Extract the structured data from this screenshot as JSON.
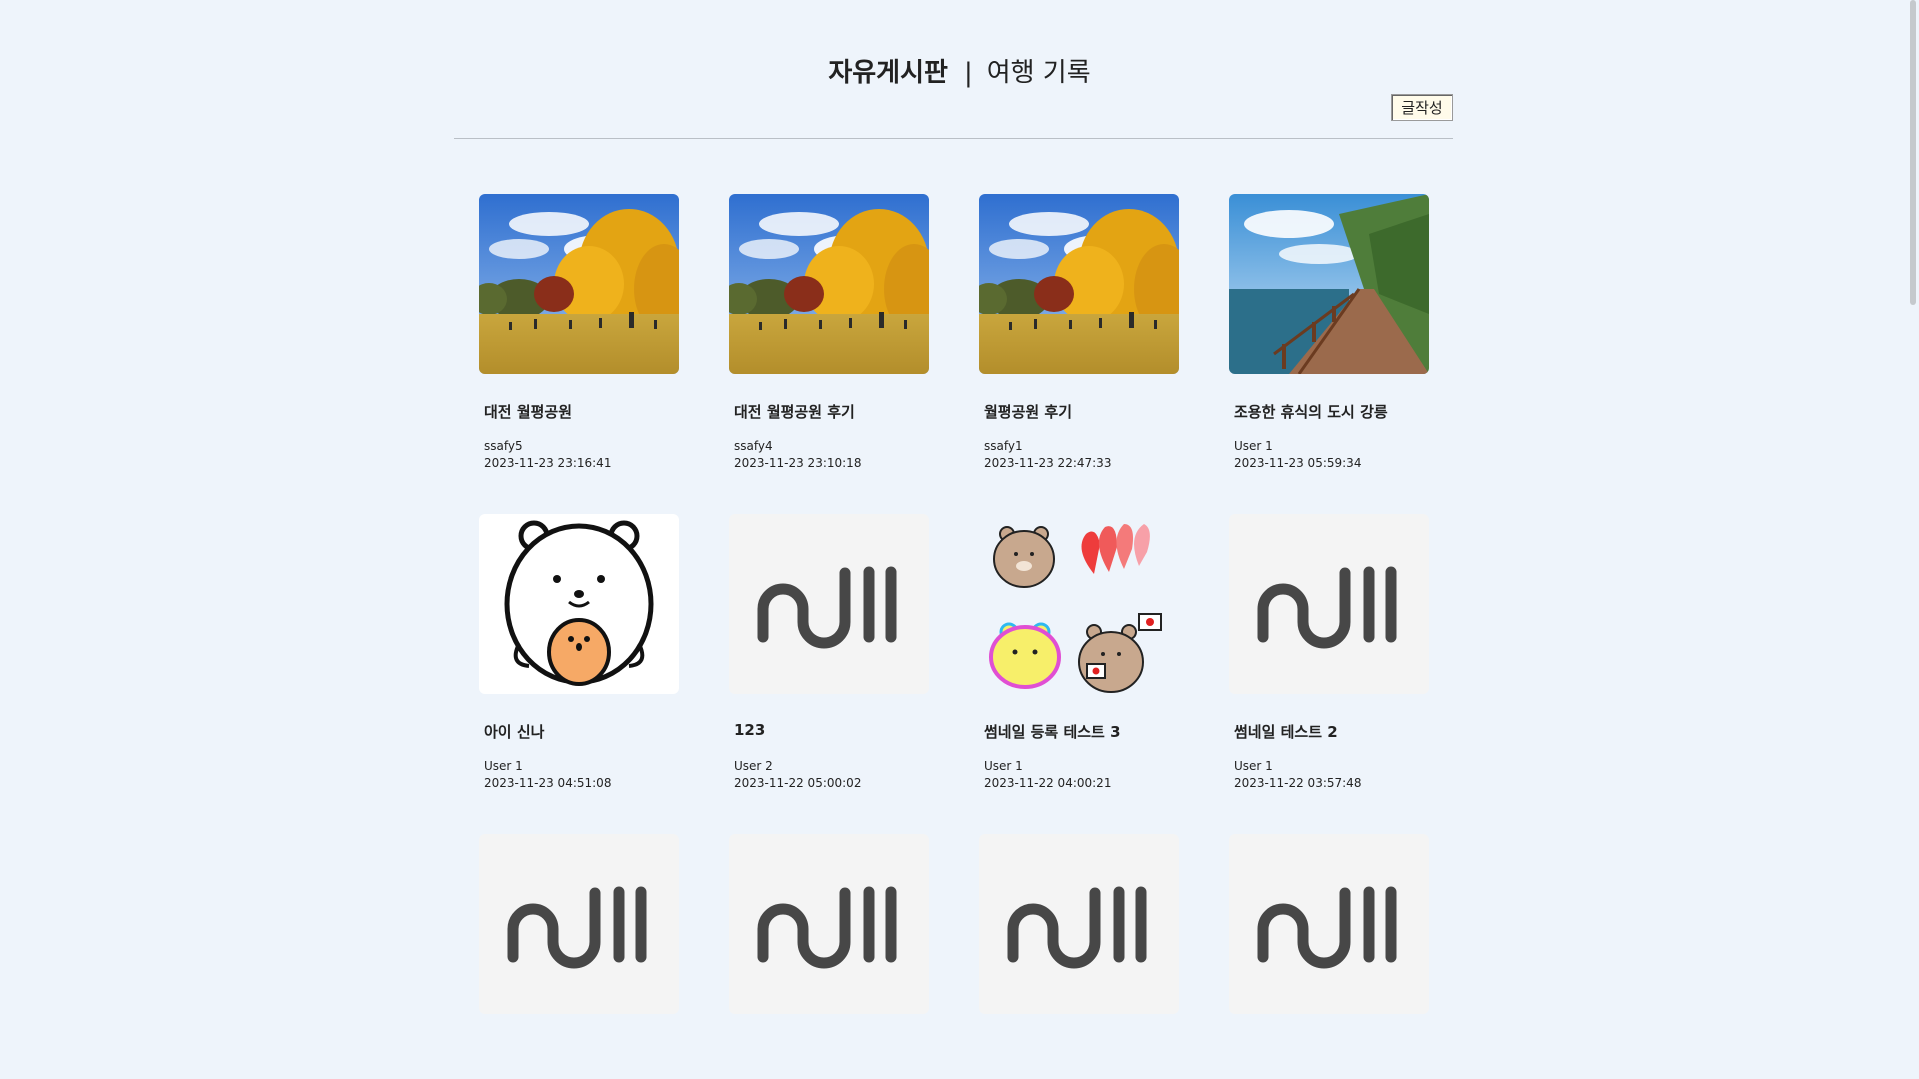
{
  "header": {
    "board": "자유게시판",
    "separator": "|",
    "travel": "여행 기록"
  },
  "write_button": "글작성",
  "posts": [
    {
      "title": "대전 월평공원",
      "author": "ssafy5",
      "date": "2023-11-23 23:16:41",
      "thumb": "ginkgo-park-photo"
    },
    {
      "title": "대전 월평공원 후기",
      "author": "ssafy4",
      "date": "2023-11-23 23:10:18",
      "thumb": "ginkgo-park-photo"
    },
    {
      "title": "월평공원 후기",
      "author": "ssafy1",
      "date": "2023-11-23 22:47:33",
      "thumb": "ginkgo-park-photo"
    },
    {
      "title": "조용한 휴식의 도시 강릉",
      "author": "User 1",
      "date": "2023-11-23 05:59:34",
      "thumb": "coast-boardwalk-photo"
    },
    {
      "title": "아이 신나",
      "author": "User 1",
      "date": "2023-11-23 04:51:08",
      "thumb": "bear-illustration"
    },
    {
      "title": "123",
      "author": "User 2",
      "date": "2023-11-22 05:00:02",
      "thumb": "null-placeholder"
    },
    {
      "title": "썸네일 등록 테스트 3",
      "author": "User 1",
      "date": "2023-11-22 04:00:21",
      "thumb": "bear-stickers"
    },
    {
      "title": "썸네일 테스트 2",
      "author": "User 1",
      "date": "2023-11-22 03:57:48",
      "thumb": "null-placeholder"
    },
    {
      "title": "",
      "author": "",
      "date": "",
      "thumb": "null-placeholder"
    },
    {
      "title": "",
      "author": "",
      "date": "",
      "thumb": "null-placeholder"
    },
    {
      "title": "",
      "author": "",
      "date": "",
      "thumb": "null-placeholder"
    },
    {
      "title": "",
      "author": "",
      "date": "",
      "thumb": "null-placeholder"
    }
  ],
  "colors": {
    "background": "#eef4fb",
    "placeholder_bg": "#f4f4f4",
    "placeholder_glyph": "#474747"
  }
}
